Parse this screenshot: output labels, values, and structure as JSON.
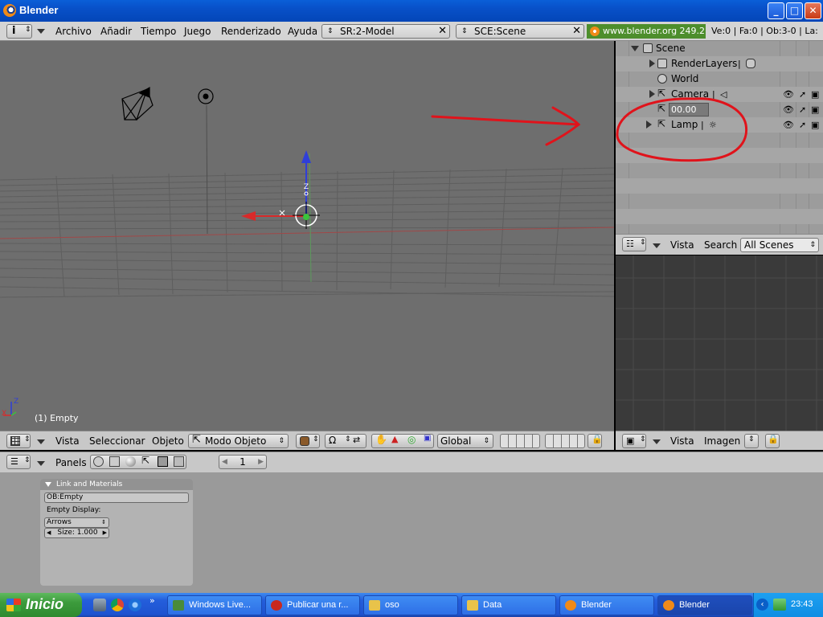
{
  "window": {
    "title": "Blender",
    "minimize": "_",
    "maximize": "□",
    "close": "✕"
  },
  "info_header": {
    "menus": [
      "Archivo",
      "Añadir",
      "Tiempo",
      "Juego",
      "Renderizado",
      "Ayuda"
    ],
    "screen": "SR:2-Model",
    "scene": "SCE:Scene",
    "website": "www.blender.org 249.2",
    "stats": "Ve:0 | Fa:0 | Ob:3-0 | La:"
  },
  "viewport": {
    "status": "(1) Empty",
    "axis_x": "X",
    "axis_z": "Z",
    "gizmo_z": "Z",
    "gizmo_x": "X"
  },
  "viewport_header": {
    "menus": [
      "Vista",
      "Seleccionar",
      "Objeto"
    ],
    "mode": "Modo Objeto",
    "orientation": "Global"
  },
  "outliner": {
    "rows": [
      {
        "label": "Scene"
      },
      {
        "label": "RenderLayers"
      },
      {
        "label": "World"
      },
      {
        "label": "Camera"
      },
      {
        "label": "00.00"
      },
      {
        "label": "Lamp"
      }
    ],
    "header": {
      "menus": [
        "Vista",
        "Search"
      ],
      "scope": "All Scenes"
    }
  },
  "image_header": {
    "menus": [
      "Vista",
      "Imagen"
    ]
  },
  "buttons_header": {
    "panels_label": "Panels",
    "frame": "1"
  },
  "panel": {
    "title": "Link and Materials",
    "object": "OB:Empty",
    "empty_display_label": "Empty Display:",
    "display_type": "Arrows",
    "size": "Size: 1.000"
  },
  "taskbar": {
    "start": "Inicio",
    "tasks": [
      {
        "label": "Windows Live...",
        "color": "#4a8b3a"
      },
      {
        "label": "Publicar una r...",
        "color": "#c8281e"
      },
      {
        "label": "oso",
        "color": "#e8c34a"
      },
      {
        "label": "Data",
        "color": "#e8c34a"
      },
      {
        "label": "Blender",
        "color": "#f08a18"
      },
      {
        "label": "Blender",
        "color": "#f08a18"
      }
    ],
    "clock": "23:43"
  },
  "annotation": {
    "color": "#e0131b"
  }
}
